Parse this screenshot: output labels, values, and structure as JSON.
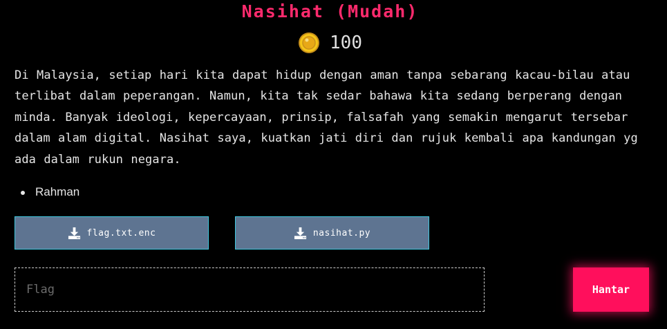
{
  "challenge": {
    "title": "Nasihat (Mudah)",
    "points": "100",
    "description": "Di Malaysia, setiap hari kita dapat hidup dengan aman tanpa sebarang kacau-bilau atau terlibat dalam peperangan. Namun, kita tak sedar bahawa kita sedang berperang dengan minda. Banyak ideologi, kepercayaan, prinsip, falsafah yang semakin mengarut tersebar dalam alam digital. Nasihat saya, kuatkan jati diri dan rujuk kembali apa kandungan yg ada dalam rukun negara.",
    "authors": [
      "Rahman"
    ]
  },
  "files": [
    {
      "name": "flag.txt.enc",
      "icon": "download-icon"
    },
    {
      "name": "nasihat.py",
      "icon": "download-icon"
    }
  ],
  "submission": {
    "placeholder": "Flag",
    "value": "",
    "submit_label": "Hantar"
  },
  "colors": {
    "background": "#000000",
    "title": "#ff2a6d",
    "file_button": "#5e7491",
    "file_button_border": "#3fc8e0",
    "submit_button": "#ff0f5c",
    "coin": "#f5c518"
  },
  "icons": {
    "points": "coin-icon",
    "file": "download-icon"
  }
}
